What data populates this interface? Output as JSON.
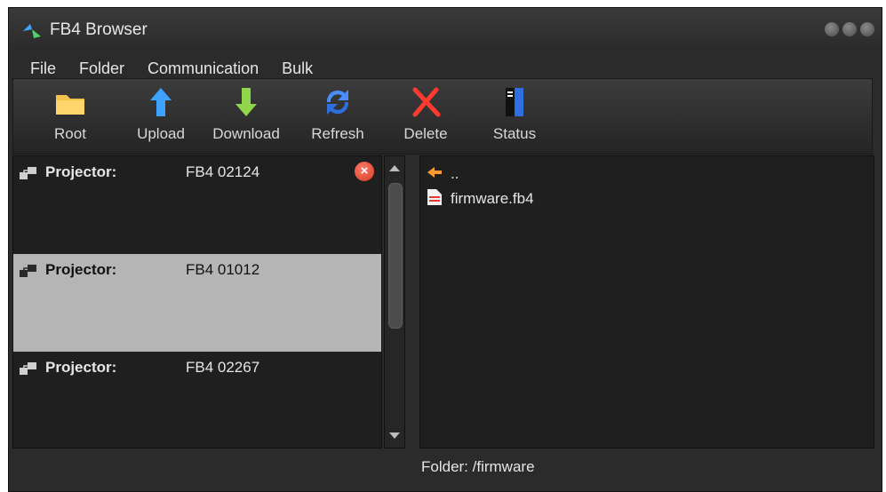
{
  "window": {
    "title": "FB4 Browser"
  },
  "menu": [
    "File",
    "Folder",
    "Communication",
    "Bulk"
  ],
  "toolbar": {
    "root_label": "Root",
    "upload_label": "Upload",
    "download_label": "Download",
    "refresh_label": "Refresh",
    "delete_label": "Delete",
    "status_label": "Status"
  },
  "devices": [
    {
      "label": "Projector:",
      "id": "FB4 02124"
    },
    {
      "label": "Projector:",
      "id": "FB4 01012"
    },
    {
      "label": "Projector:",
      "id": "FB4 02267"
    }
  ],
  "files": {
    "parent": "..",
    "items": [
      "firmware.fb4"
    ]
  },
  "status": {
    "folder": "Folder: /firmware"
  },
  "colors": {
    "selected_row": "#b5b5b5",
    "panel_bg": "#1f1f1f",
    "window_bg": "#2b2b2b",
    "close_badge": "#d23a23"
  }
}
